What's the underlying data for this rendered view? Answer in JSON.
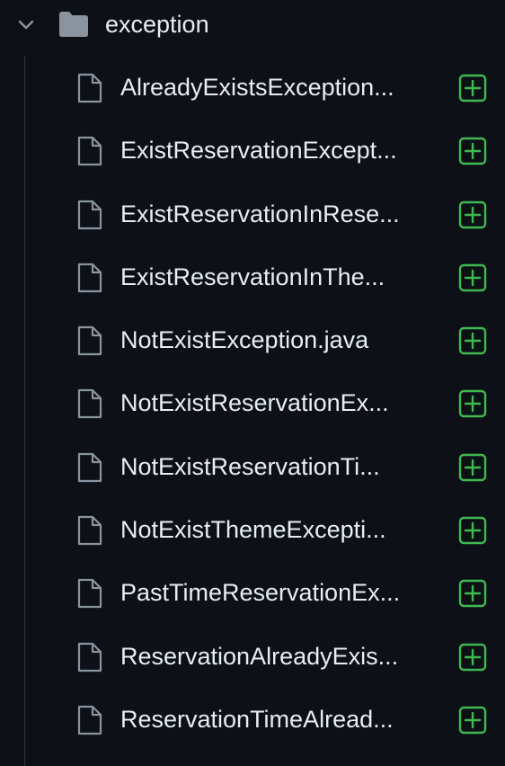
{
  "folder": {
    "name": "exception",
    "expanded": true,
    "chevron_icon": "chevron-down-icon",
    "folder_icon": "folder-icon"
  },
  "colors": {
    "background": "#0d1117",
    "text": "#e6edf3",
    "icon_gray": "#8b949e",
    "add_green": "#3fb950",
    "guide_line": "#30363d"
  },
  "files": [
    {
      "name": "AlreadyExistsException...",
      "icon": "file-icon",
      "action_icon": "plus-square-icon"
    },
    {
      "name": "ExistReservationExcept...",
      "icon": "file-icon",
      "action_icon": "plus-square-icon"
    },
    {
      "name": "ExistReservationInRese...",
      "icon": "file-icon",
      "action_icon": "plus-square-icon"
    },
    {
      "name": "ExistReservationInThe...",
      "icon": "file-icon",
      "action_icon": "plus-square-icon"
    },
    {
      "name": "NotExistException.java",
      "icon": "file-icon",
      "action_icon": "plus-square-icon"
    },
    {
      "name": "NotExistReservationEx...",
      "icon": "file-icon",
      "action_icon": "plus-square-icon"
    },
    {
      "name": "NotExistReservationTi...",
      "icon": "file-icon",
      "action_icon": "plus-square-icon"
    },
    {
      "name": "NotExistThemeExcepti...",
      "icon": "file-icon",
      "action_icon": "plus-square-icon"
    },
    {
      "name": "PastTimeReservationEx...",
      "icon": "file-icon",
      "action_icon": "plus-square-icon"
    },
    {
      "name": "ReservationAlreadyExis...",
      "icon": "file-icon",
      "action_icon": "plus-square-icon"
    },
    {
      "name": "ReservationTimeAlread...",
      "icon": "file-icon",
      "action_icon": "plus-square-icon"
    }
  ]
}
